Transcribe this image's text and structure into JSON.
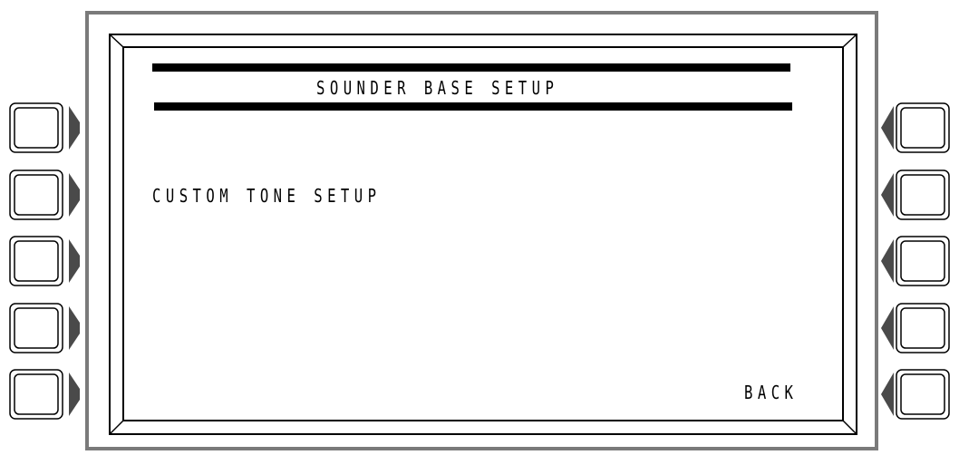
{
  "screen": {
    "title": "SOUNDER BASE SETUP",
    "menu_items": [
      {
        "label": "CUSTOM TONE SETUP"
      }
    ],
    "back_label": "BACK"
  },
  "softkeys": {
    "left": [
      "left-softkey-1",
      "left-softkey-2",
      "left-softkey-3",
      "left-softkey-4",
      "left-softkey-5"
    ],
    "right": [
      "right-softkey-1",
      "right-softkey-2",
      "right-softkey-3",
      "right-softkey-4",
      "right-softkey-5"
    ]
  },
  "colors": {
    "frame": "#7a7a7a",
    "arrow": "#4a4a4a",
    "text": "#000000",
    "background": "#ffffff"
  }
}
